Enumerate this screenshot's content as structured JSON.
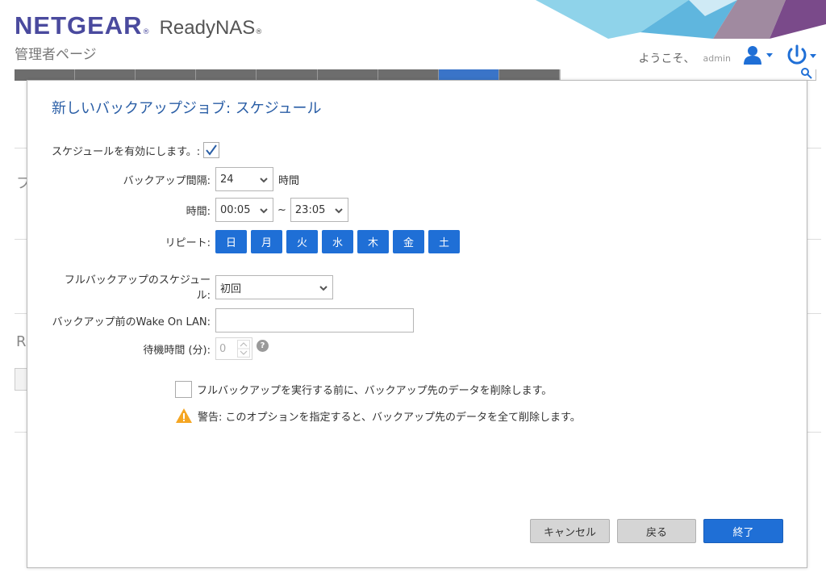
{
  "header": {
    "brand": "NETGEAR",
    "product": "ReadyNAS",
    "admin_page": "管理者ページ",
    "welcome": "ようこそ、",
    "username": "admin"
  },
  "background": {
    "fragment_1": "フ",
    "fragment_2": "R"
  },
  "dialog": {
    "title": "新しいバックアップジョブ: スケジュール",
    "enable_label": "スケジュールを有効にします。:",
    "enable_checked": true,
    "interval_label": "バックアップ間隔:",
    "interval_value": "24",
    "interval_unit": "時間",
    "time_label": "時間:",
    "time_start": "00:05",
    "time_tilde": "~",
    "time_end": "23:05",
    "repeat_label": "リピート:",
    "days": [
      "日",
      "月",
      "火",
      "水",
      "木",
      "金",
      "土"
    ],
    "full_backup_label_1": "フルバックアップのスケジュー",
    "full_backup_label_2": "ル:",
    "full_backup_value": "初回",
    "wol_label": "バックアップ前のWake On LAN:",
    "wol_value": "",
    "wait_label": "待機時間 (分):",
    "wait_value": "0",
    "help": "?",
    "delete_checkbox_label": "フルバックアップを実行する前に、バックアップ先のデータを削除します。",
    "warning_text": "警告: このオプションを指定すると、バックアップ先のデータを全て削除します。",
    "cancel_label": "キャンセル",
    "back_label": "戻る",
    "finish_label": "終了"
  },
  "colors": {
    "accent": "#1f6fd6",
    "title": "#2a5ea6",
    "brand": "#4a4a9e",
    "warning": "#f5a623"
  }
}
